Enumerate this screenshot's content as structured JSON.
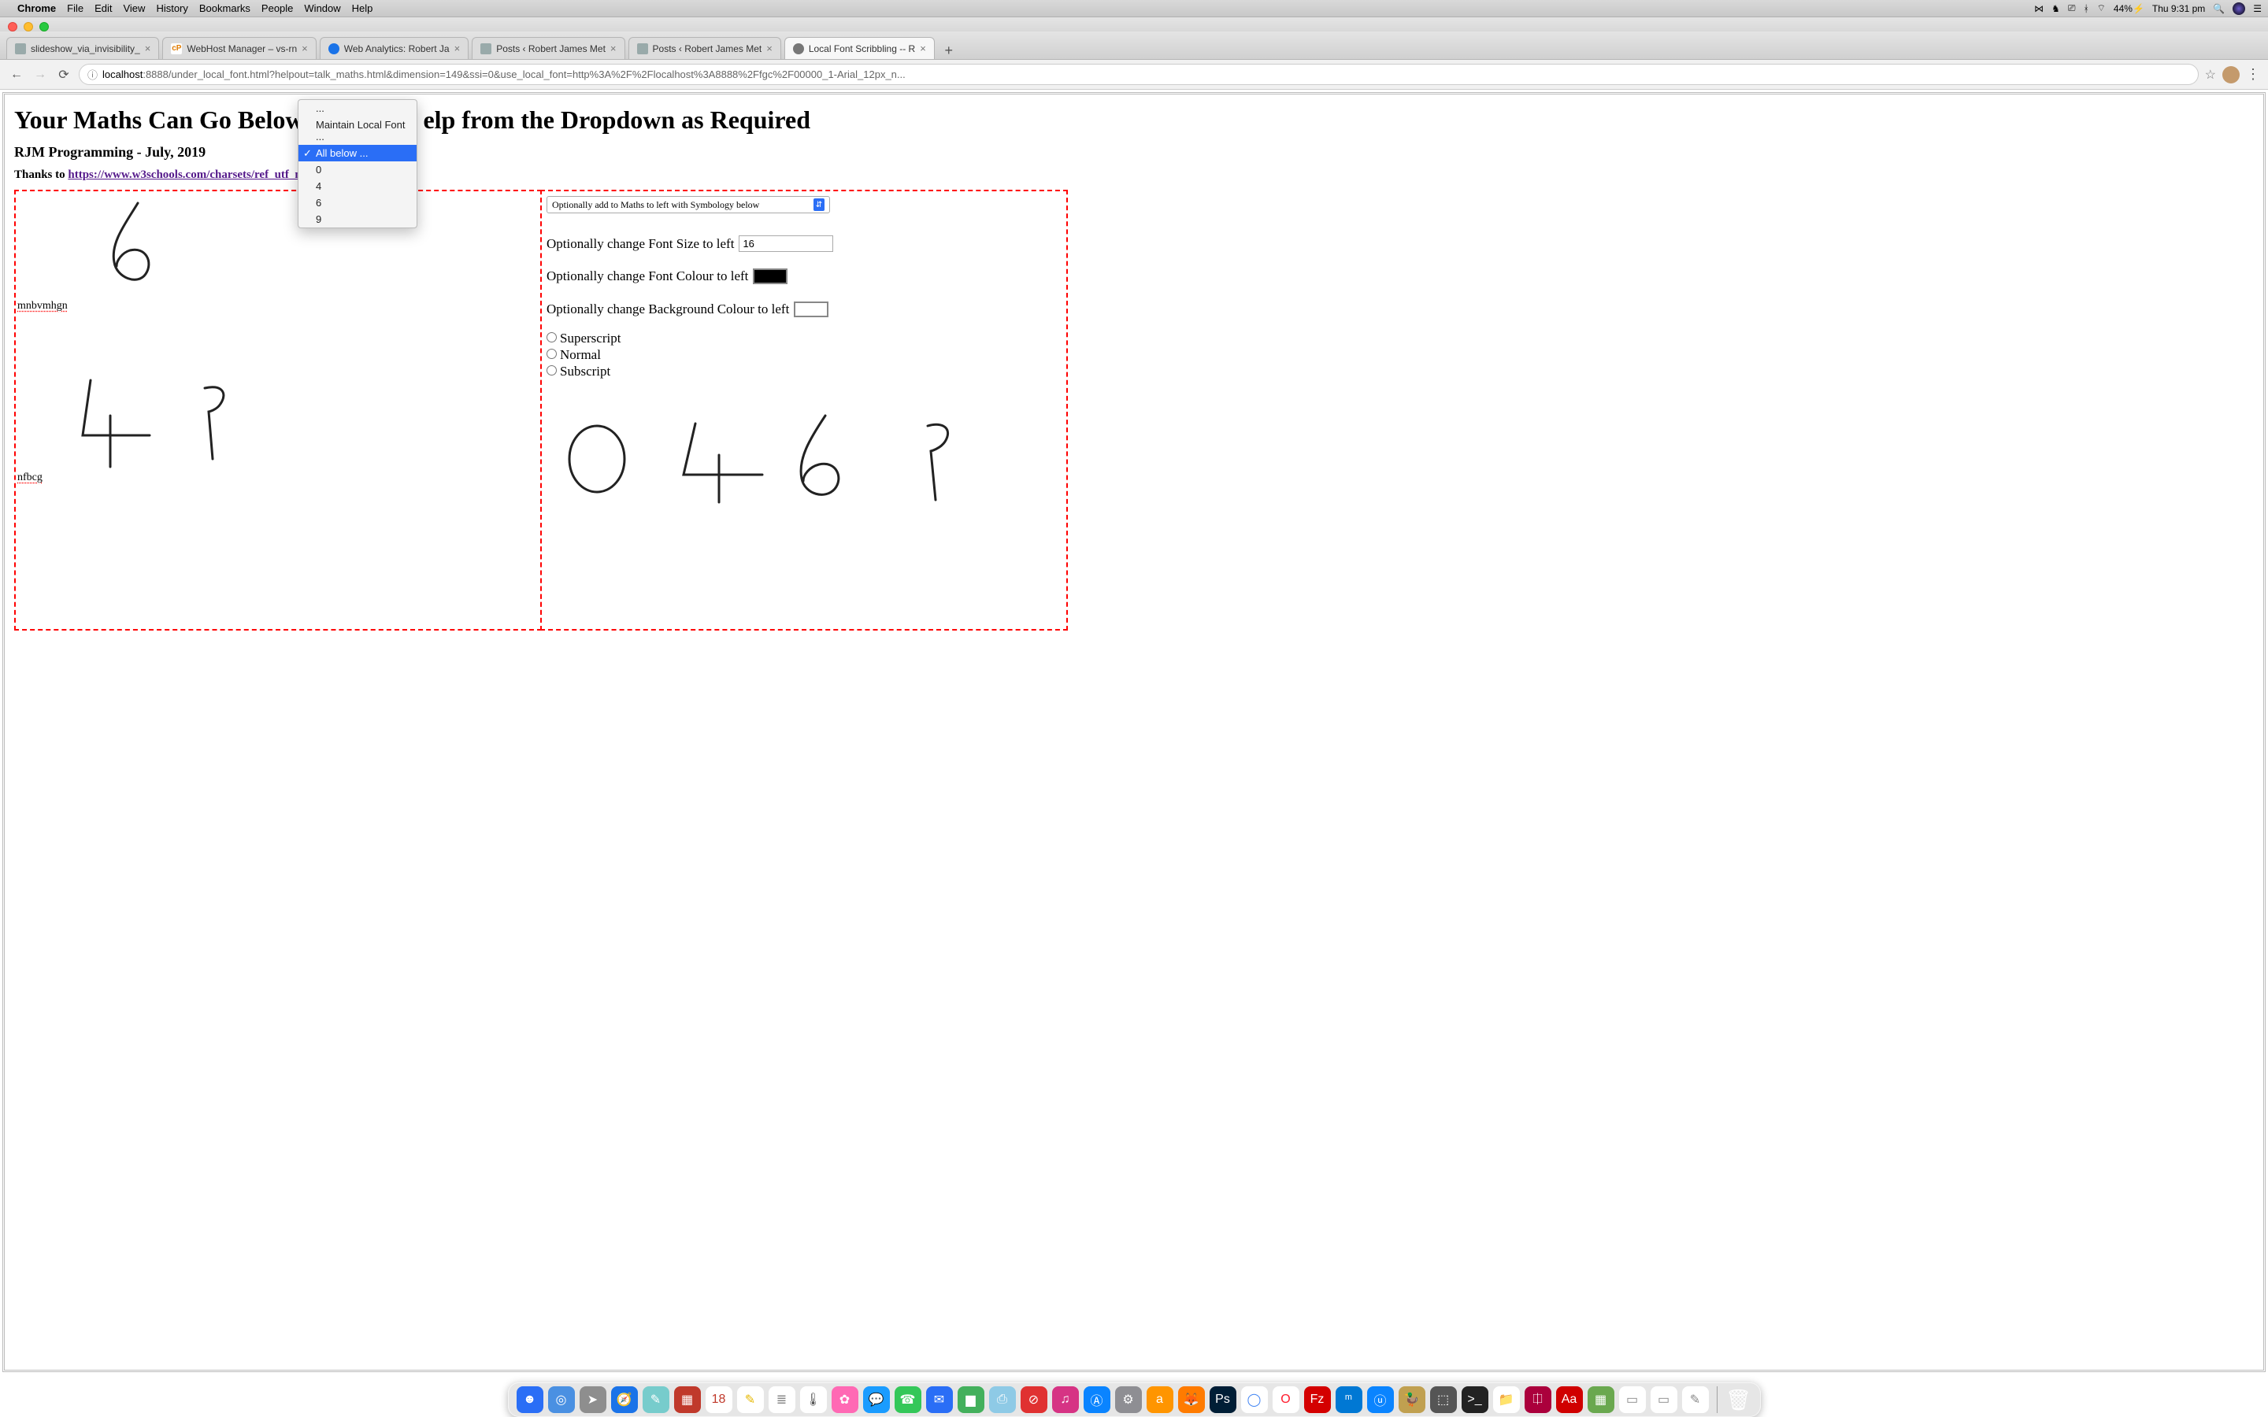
{
  "menubar": {
    "app": "Chrome",
    "items": [
      "File",
      "Edit",
      "View",
      "History",
      "Bookmarks",
      "People",
      "Window",
      "Help"
    ],
    "right": {
      "battery": "44%",
      "clock": "Thu 9:31 pm"
    }
  },
  "tabs": [
    {
      "title": "slideshow_via_invisibility_",
      "favicon": "#9aa"
    },
    {
      "title": "WebHost Manager – vs-rn",
      "favicon": "#e07b00",
      "prefix": "cP"
    },
    {
      "title": "Web Analytics: Robert Ja",
      "favicon": "#1a73e8"
    },
    {
      "title": "Posts ‹ Robert James Met",
      "favicon": "#9aa"
    },
    {
      "title": "Posts ‹ Robert James Met",
      "favicon": "#9aa"
    },
    {
      "title": "Local Font Scribbling -- R",
      "favicon": "#777",
      "active": true
    }
  ],
  "url": {
    "host": "localhost",
    "port": ":8888",
    "path": "/under_local_font.html?helpout=talk_maths.html&dimension=149&ssi=0&use_local_font=http%3A%2F%2Flocalhost%3A8888%2Ffgc%2F00000_1-Arial_12px_n..."
  },
  "page": {
    "h1_left": "Your Maths Can Go Below",
    "h1_right": "elp from the Dropdown as Required",
    "subtitle": "RJM Programming - July, 2019",
    "thanks_prefix": "Thanks to ",
    "thanks_link": "https://www.w3schools.com/charsets/ref_utf_math.asp"
  },
  "dropdown": {
    "options": [
      "...",
      "Maintain Local Font ...",
      "All below ...",
      "0",
      "4",
      "6",
      "9"
    ],
    "selected": "All below ..."
  },
  "left_text1": "mnbvmhgn",
  "left_text2": "nfbcg",
  "right": {
    "symbology": "Optionally add to Maths to left with Symbology below",
    "fontsize_label": "Optionally change Font Size to left",
    "fontsize_value": "16",
    "fontcolor_label": "Optionally change Font Colour to left",
    "bgcolor_label": "Optionally change Background Colour to left",
    "r1": "Superscript",
    "r2": "Normal",
    "r3": "Subscript"
  },
  "dock_apps": [
    {
      "c": "#2a6ef6",
      "g": "☻"
    },
    {
      "c": "#4a90e2",
      "g": "◎"
    },
    {
      "c": "#8e8e8e",
      "g": "➤"
    },
    {
      "c": "#1a73e8",
      "g": "🧭"
    },
    {
      "c": "#7cc",
      "g": "✎"
    },
    {
      "c": "#c0392b",
      "g": "▦"
    },
    {
      "c": "#fff",
      "g": "18",
      "t": "#c0392b"
    },
    {
      "c": "#fff",
      "g": "✎",
      "t": "#e6b800"
    },
    {
      "c": "#fff",
      "g": "≣",
      "t": "#888"
    },
    {
      "c": "#fff",
      "g": "🌡",
      "t": "#555"
    },
    {
      "c": "#ff69b4",
      "g": "✿"
    },
    {
      "c": "#1a9cff",
      "g": "💬"
    },
    {
      "c": "#34c759",
      "g": "☎"
    },
    {
      "c": "#2a6ef6",
      "g": "✉"
    },
    {
      "c": "#43b05c",
      "g": "▆"
    },
    {
      "c": "#8ecae6",
      "g": "⎙"
    },
    {
      "c": "#e03131",
      "g": "⊘"
    },
    {
      "c": "#d63384",
      "g": "♫"
    },
    {
      "c": "#0a84ff",
      "g": "Ⓐ"
    },
    {
      "c": "#8e8e93",
      "g": "⚙"
    },
    {
      "c": "#ff9500",
      "g": "a"
    },
    {
      "c": "#ff7b00",
      "g": "🦊"
    },
    {
      "c": "#001e36",
      "g": "Ps"
    },
    {
      "c": "#fff",
      "g": "◯",
      "t": "#4285f4"
    },
    {
      "c": "#fff",
      "g": "O",
      "t": "#ff1b2d"
    },
    {
      "c": "#d40000",
      "g": "Fz"
    },
    {
      "c": "#0078d4",
      "g": "ᵐ"
    },
    {
      "c": "#0a84ff",
      "g": "ⓤ"
    },
    {
      "c": "#c0a050",
      "g": "🦆"
    },
    {
      "c": "#555",
      "g": "⬚"
    },
    {
      "c": "#222",
      "g": ">_"
    },
    {
      "c": "#fff",
      "g": "📁",
      "t": "#1a73e8"
    },
    {
      "c": "#ab003c",
      "g": "⎅"
    },
    {
      "c": "#d00000",
      "g": "Aa"
    },
    {
      "c": "#6aa84f",
      "g": "▦"
    },
    {
      "c": "#fff",
      "g": "▭",
      "t": "#888"
    },
    {
      "c": "#fff",
      "g": "▭",
      "t": "#888"
    },
    {
      "c": "#fff",
      "g": "✎",
      "t": "#888"
    }
  ],
  "trash": "🗑"
}
